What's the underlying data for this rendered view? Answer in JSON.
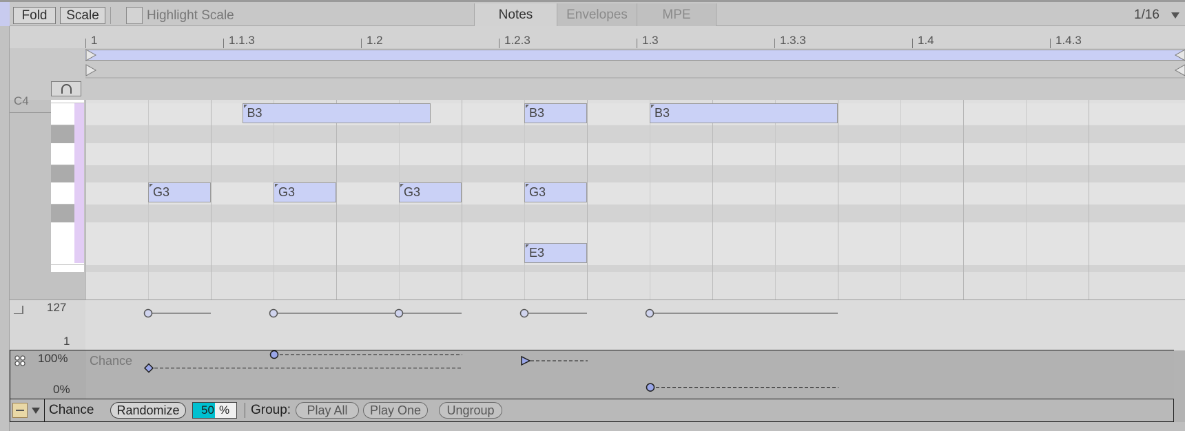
{
  "toolbar": {
    "fold_label": "Fold",
    "scale_label": "Scale",
    "highlight_scale_label": "Highlight Scale",
    "tabs": [
      {
        "label": "Notes",
        "active": true
      },
      {
        "label": "Envelopes",
        "active": false
      },
      {
        "label": "MPE",
        "active": false
      }
    ],
    "grid_value": "1/16"
  },
  "ruler": {
    "labels": [
      "1",
      "1.1.3",
      "1.2",
      "1.2.3",
      "1.3",
      "1.3.3",
      "1.4",
      "1.4.3"
    ]
  },
  "piano": {
    "visible_key_label": "C4"
  },
  "notes": [
    {
      "pitch": "B3",
      "start": 1.25,
      "length": 1.5
    },
    {
      "pitch": "B3",
      "start": 3.5,
      "length": 0.5
    },
    {
      "pitch": "B3",
      "start": 4.5,
      "length": 1.5
    },
    {
      "pitch": "G3",
      "start": 0.5,
      "length": 0.5
    },
    {
      "pitch": "G3",
      "start": 1.5,
      "length": 0.5
    },
    {
      "pitch": "G3",
      "start": 2.5,
      "length": 0.5
    },
    {
      "pitch": "G3",
      "start": 3.5,
      "length": 0.5
    },
    {
      "pitch": "E3",
      "start": 3.5,
      "length": 0.5
    }
  ],
  "velocity": {
    "max_label": "127",
    "min_label": "1",
    "points": [
      {
        "start": 0.5,
        "end": 1.0,
        "value": 127
      },
      {
        "start": 1.5,
        "end": 2.5,
        "value": 127
      },
      {
        "start": 2.5,
        "end": 3.0,
        "value": 127
      },
      {
        "start": 3.5,
        "end": 4.0,
        "value": 127
      },
      {
        "start": 4.5,
        "end": 6.0,
        "value": 127
      }
    ]
  },
  "chance": {
    "lane_label": "Chance",
    "max_label": "100%",
    "min_label": "0%",
    "points": [
      {
        "start": 0.5,
        "end": 3.0,
        "value": 65,
        "shape": "diamond"
      },
      {
        "start": 1.5,
        "end": 3.0,
        "value": 100,
        "shape": "circle"
      },
      {
        "start": 3.5,
        "end": 4.0,
        "value": 84,
        "shape": "triangle"
      },
      {
        "start": 4.5,
        "end": 6.0,
        "value": 15,
        "shape": "circle"
      }
    ]
  },
  "bottom": {
    "chance_label": "Chance",
    "randomize_label": "Randomize",
    "percent_value": "50",
    "percent_unit": "%",
    "group_label": "Group:",
    "play_all_label": "Play All",
    "play_one_label": "Play One",
    "ungroup_label": "Ungroup"
  },
  "colors": {
    "note_fill": "#cad1f6",
    "loop_brace": "#c9cff5",
    "percent_fill": "#00c0d0",
    "key_accent": "#e2ccf5"
  }
}
